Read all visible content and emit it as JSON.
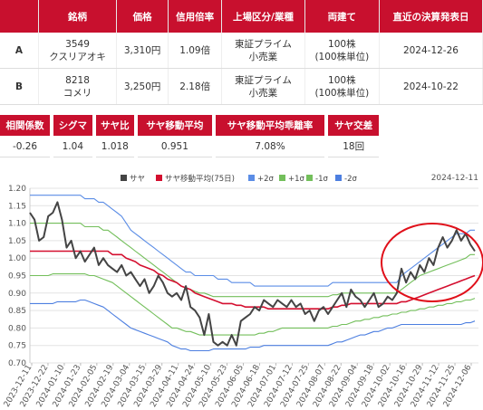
{
  "table": {
    "headers": [
      "銘柄",
      "価格",
      "信用倍率",
      "上場区分/業種",
      "両建て",
      "直近の決算発表日"
    ],
    "rows": [
      {
        "id": "A",
        "code": "3549",
        "name": "クスリアオキ",
        "price": "3,310円",
        "ratio": "1.09倍",
        "market": "東証プライム",
        "sector": "小売業",
        "unit": "100株",
        "unit2": "(100株単位)",
        "date": "2024-12-26"
      },
      {
        "id": "B",
        "code": "8218",
        "name": "コメリ",
        "price": "3,250円",
        "ratio": "2.18倍",
        "market": "東証プライム",
        "sector": "小売業",
        "unit": "100株",
        "unit2": "(100株単位)",
        "date": "2024-10-22"
      }
    ]
  },
  "stats": {
    "headers": [
      "相関係数",
      "シグマ",
      "サヤ比",
      "サヤ移動平均",
      "サヤ移動平均乖離率",
      "サヤ交差"
    ],
    "values": [
      "-0.26",
      "1.04",
      "1.018",
      "0.951",
      "7.08%",
      "18回"
    ]
  },
  "colors": {
    "header_red": "#c8102e",
    "saya": "#444444",
    "ma": "#d40f2f",
    "plus2": "#5b8de6",
    "plus1": "#73bf5b",
    "minus1": "#73bf5b",
    "minus2": "#4d7fe0",
    "annotation": "#e0101a"
  },
  "chart_data": {
    "type": "line",
    "date_label": "2024-12-11",
    "legend": [
      "サヤ",
      "サヤ移動平均(75日)",
      "+2σ",
      "+1σ",
      "-1σ",
      "-2σ"
    ],
    "y_ticks": [
      "1.20",
      "1.15",
      "1.10",
      "1.05",
      "1.00",
      "0.95",
      "0.90",
      "0.85",
      "0.80",
      "0.75",
      "0.70"
    ],
    "ylim": [
      0.7,
      1.2
    ],
    "x_labels": [
      "2023-12-11",
      "2023-12-22",
      "2024-01-10",
      "2024-01-23",
      "2024-02-05",
      "2024-02-19",
      "2024-03-04",
      "2024-03-15",
      "2024-03-29",
      "2024-04-11",
      "2024-04-24",
      "2024-05-10",
      "2024-05-23",
      "2024-06-05",
      "2024-06-18",
      "2024-07-01",
      "2024-07-12",
      "2024-07-25",
      "2024-08-07",
      "2024-08-22",
      "2024-09-04",
      "2024-09-18",
      "2024-10-02",
      "2024-10-16",
      "2024-10-29",
      "2024-11-12",
      "2024-11-25",
      "2024-12-06"
    ],
    "series": [
      {
        "name": "サヤ",
        "values": [
          1.13,
          1.11,
          1.05,
          1.06,
          1.12,
          1.13,
          1.16,
          1.11,
          1.03,
          1.05,
          1.0,
          1.02,
          0.99,
          1.01,
          1.03,
          0.98,
          1.0,
          0.98,
          0.97,
          0.96,
          0.98,
          0.95,
          0.96,
          0.94,
          0.92,
          0.94,
          0.9,
          0.92,
          0.95,
          0.93,
          0.9,
          0.89,
          0.9,
          0.88,
          0.92,
          0.86,
          0.85,
          0.83,
          0.78,
          0.84,
          0.76,
          0.75,
          0.76,
          0.75,
          0.78,
          0.75,
          0.82,
          0.83,
          0.84,
          0.86,
          0.85,
          0.88,
          0.87,
          0.86,
          0.88,
          0.87,
          0.86,
          0.88,
          0.86,
          0.87,
          0.84,
          0.85,
          0.82,
          0.85,
          0.86,
          0.84,
          0.86,
          0.88,
          0.9,
          0.86,
          0.91,
          0.89,
          0.88,
          0.86,
          0.88,
          0.9,
          0.86,
          0.87,
          0.89,
          0.88,
          0.9,
          0.97,
          0.93,
          0.96,
          0.94,
          0.98,
          0.96,
          1.0,
          0.98,
          1.03,
          1.06,
          1.03,
          1.05,
          1.08,
          1.05,
          1.07,
          1.04,
          1.02
        ]
      },
      {
        "name": "サヤ移動平均(75日)",
        "values": [
          1.02,
          1.02,
          1.02,
          1.02,
          1.02,
          1.02,
          1.02,
          1.02,
          1.02,
          1.02,
          1.02,
          1.02,
          1.02,
          1.02,
          1.02,
          1.02,
          1.02,
          1.02,
          1.01,
          1.01,
          1.01,
          1.0,
          0.995,
          0.99,
          0.98,
          0.975,
          0.97,
          0.965,
          0.955,
          0.95,
          0.94,
          0.935,
          0.93,
          0.92,
          0.915,
          0.91,
          0.9,
          0.895,
          0.89,
          0.885,
          0.88,
          0.875,
          0.87,
          0.87,
          0.87,
          0.865,
          0.865,
          0.86,
          0.86,
          0.86,
          0.86,
          0.86,
          0.855,
          0.855,
          0.855,
          0.855,
          0.855,
          0.855,
          0.855,
          0.855,
          0.855,
          0.855,
          0.855,
          0.855,
          0.855,
          0.855,
          0.86,
          0.86,
          0.865,
          0.865,
          0.87,
          0.87,
          0.87,
          0.87,
          0.87,
          0.87,
          0.87,
          0.87,
          0.87,
          0.87,
          0.87,
          0.875,
          0.875,
          0.88,
          0.885,
          0.89,
          0.895,
          0.9,
          0.905,
          0.91,
          0.915,
          0.92,
          0.925,
          0.93,
          0.935,
          0.94,
          0.945,
          0.95
        ]
      },
      {
        "name": "+2σ",
        "values": [
          1.18,
          1.18,
          1.18,
          1.18,
          1.18,
          1.18,
          1.18,
          1.18,
          1.18,
          1.18,
          1.18,
          1.18,
          1.17,
          1.17,
          1.17,
          1.16,
          1.16,
          1.15,
          1.14,
          1.13,
          1.12,
          1.1,
          1.08,
          1.07,
          1.06,
          1.05,
          1.04,
          1.03,
          1.02,
          1.01,
          1.0,
          0.99,
          0.98,
          0.97,
          0.96,
          0.96,
          0.95,
          0.95,
          0.95,
          0.95,
          0.95,
          0.94,
          0.94,
          0.94,
          0.93,
          0.93,
          0.93,
          0.93,
          0.93,
          0.92,
          0.92,
          0.92,
          0.92,
          0.92,
          0.92,
          0.92,
          0.92,
          0.92,
          0.92,
          0.92,
          0.92,
          0.92,
          0.92,
          0.92,
          0.92,
          0.92,
          0.93,
          0.93,
          0.93,
          0.93,
          0.93,
          0.93,
          0.93,
          0.93,
          0.93,
          0.93,
          0.93,
          0.93,
          0.93,
          0.93,
          0.93,
          0.95,
          0.96,
          0.97,
          0.98,
          0.99,
          1.0,
          1.01,
          1.02,
          1.03,
          1.04,
          1.05,
          1.06,
          1.07,
          1.07,
          1.07,
          1.08,
          1.08
        ]
      },
      {
        "name": "+1σ",
        "values": [
          1.1,
          1.1,
          1.1,
          1.1,
          1.1,
          1.1,
          1.1,
          1.1,
          1.1,
          1.1,
          1.1,
          1.1,
          1.09,
          1.09,
          1.09,
          1.09,
          1.08,
          1.08,
          1.07,
          1.06,
          1.05,
          1.04,
          1.03,
          1.02,
          1.01,
          1.0,
          0.99,
          0.98,
          0.97,
          0.96,
          0.95,
          0.94,
          0.93,
          0.92,
          0.915,
          0.91,
          0.905,
          0.9,
          0.9,
          0.895,
          0.89,
          0.89,
          0.89,
          0.89,
          0.89,
          0.89,
          0.89,
          0.89,
          0.89,
          0.89,
          0.89,
          0.89,
          0.89,
          0.89,
          0.89,
          0.89,
          0.89,
          0.89,
          0.89,
          0.89,
          0.89,
          0.89,
          0.89,
          0.89,
          0.89,
          0.89,
          0.895,
          0.895,
          0.9,
          0.9,
          0.9,
          0.9,
          0.9,
          0.9,
          0.9,
          0.9,
          0.9,
          0.9,
          0.9,
          0.9,
          0.9,
          0.91,
          0.92,
          0.93,
          0.94,
          0.95,
          0.955,
          0.96,
          0.965,
          0.97,
          0.975,
          0.98,
          0.985,
          0.99,
          0.995,
          1.0,
          1.01,
          1.01
        ]
      },
      {
        "name": "-1σ",
        "values": [
          0.95,
          0.95,
          0.95,
          0.95,
          0.95,
          0.955,
          0.955,
          0.955,
          0.955,
          0.955,
          0.955,
          0.955,
          0.955,
          0.95,
          0.95,
          0.945,
          0.94,
          0.935,
          0.93,
          0.92,
          0.91,
          0.9,
          0.89,
          0.88,
          0.87,
          0.86,
          0.85,
          0.84,
          0.83,
          0.82,
          0.81,
          0.8,
          0.8,
          0.795,
          0.79,
          0.79,
          0.785,
          0.78,
          0.78,
          0.78,
          0.78,
          0.78,
          0.78,
          0.78,
          0.78,
          0.78,
          0.78,
          0.78,
          0.78,
          0.78,
          0.785,
          0.785,
          0.79,
          0.79,
          0.795,
          0.8,
          0.8,
          0.8,
          0.8,
          0.8,
          0.8,
          0.8,
          0.8,
          0.8,
          0.8,
          0.8,
          0.805,
          0.805,
          0.81,
          0.81,
          0.815,
          0.82,
          0.82,
          0.825,
          0.825,
          0.83,
          0.83,
          0.835,
          0.835,
          0.84,
          0.84,
          0.845,
          0.845,
          0.85,
          0.85,
          0.855,
          0.855,
          0.86,
          0.86,
          0.865,
          0.865,
          0.87,
          0.87,
          0.875,
          0.875,
          0.88,
          0.88,
          0.885
        ]
      },
      {
        "name": "-2σ",
        "values": [
          0.87,
          0.87,
          0.87,
          0.87,
          0.87,
          0.87,
          0.875,
          0.875,
          0.875,
          0.875,
          0.875,
          0.88,
          0.88,
          0.875,
          0.87,
          0.865,
          0.86,
          0.85,
          0.84,
          0.83,
          0.82,
          0.81,
          0.8,
          0.795,
          0.79,
          0.785,
          0.78,
          0.775,
          0.77,
          0.765,
          0.76,
          0.75,
          0.745,
          0.74,
          0.74,
          0.735,
          0.735,
          0.735,
          0.735,
          0.735,
          0.74,
          0.74,
          0.74,
          0.74,
          0.74,
          0.74,
          0.74,
          0.74,
          0.745,
          0.745,
          0.745,
          0.75,
          0.75,
          0.75,
          0.75,
          0.75,
          0.75,
          0.75,
          0.75,
          0.75,
          0.75,
          0.75,
          0.75,
          0.75,
          0.75,
          0.75,
          0.755,
          0.76,
          0.76,
          0.765,
          0.77,
          0.775,
          0.78,
          0.78,
          0.785,
          0.79,
          0.79,
          0.795,
          0.8,
          0.8,
          0.805,
          0.81,
          0.81,
          0.81,
          0.81,
          0.81,
          0.81,
          0.81,
          0.81,
          0.81,
          0.81,
          0.81,
          0.81,
          0.81,
          0.81,
          0.815,
          0.815,
          0.82
        ]
      }
    ]
  }
}
